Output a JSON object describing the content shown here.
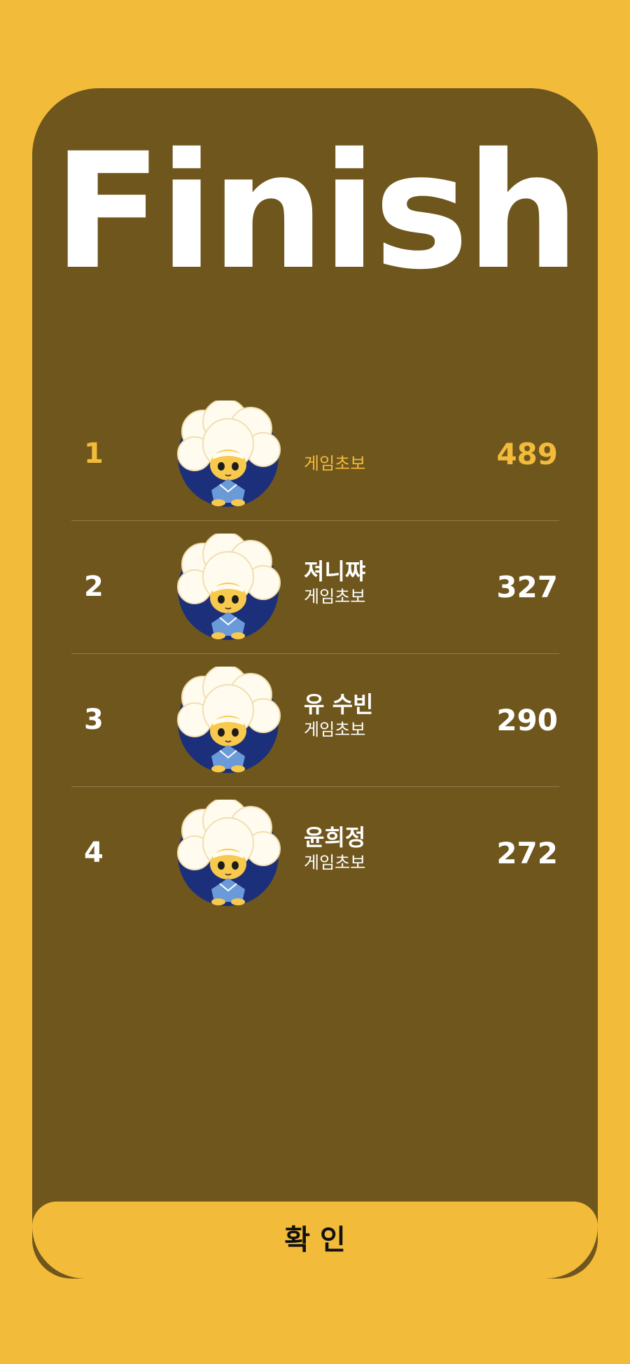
{
  "title": "Finish",
  "colors": {
    "background": "#f3bb3a",
    "card": "#6f561d",
    "highlight": "#f3bb3a",
    "text": "#ffffff"
  },
  "ranking": [
    {
      "rank": "1",
      "name": "",
      "subtitle": "게임초보",
      "score": "489",
      "avatar": "avatar-cloud-hair-character"
    },
    {
      "rank": "2",
      "name": "져니쨔",
      "subtitle": "게임초보",
      "score": "327",
      "avatar": "avatar-cloud-hair-character"
    },
    {
      "rank": "3",
      "name": "유 수빈",
      "subtitle": "게임초보",
      "score": "290",
      "avatar": "avatar-cloud-hair-character"
    },
    {
      "rank": "4",
      "name": "윤희정",
      "subtitle": "게임초보",
      "score": "272",
      "avatar": "avatar-cloud-hair-character"
    }
  ],
  "confirm_label": "확  인"
}
